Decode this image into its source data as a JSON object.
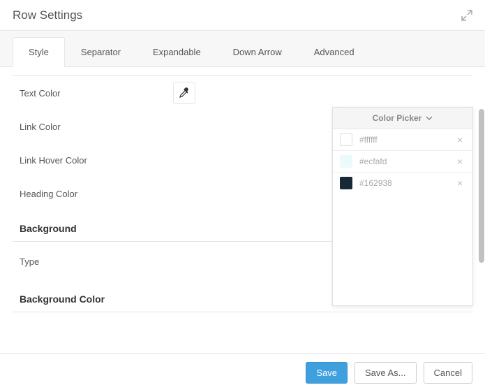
{
  "header": {
    "title": "Row Settings"
  },
  "tabs": [
    {
      "label": "Style",
      "active": true
    },
    {
      "label": "Separator",
      "active": false
    },
    {
      "label": "Expandable",
      "active": false
    },
    {
      "label": "Down Arrow",
      "active": false
    },
    {
      "label": "Advanced",
      "active": false
    }
  ],
  "fields": {
    "text_color": "Text Color",
    "link_color": "Link Color",
    "link_hover_color": "Link Hover Color",
    "heading_color": "Heading Color",
    "type": "Type"
  },
  "sections": {
    "background": "Background",
    "background_color": "Background Color"
  },
  "color_picker": {
    "title": "Color Picker",
    "entries": [
      {
        "hex": "#ffffff",
        "swatch": "#ffffff"
      },
      {
        "hex": "#ecfafd",
        "swatch": "#ecfafd"
      },
      {
        "hex": "#162938",
        "swatch": "#162938"
      }
    ]
  },
  "footer": {
    "save": "Save",
    "save_as": "Save As...",
    "cancel": "Cancel"
  }
}
